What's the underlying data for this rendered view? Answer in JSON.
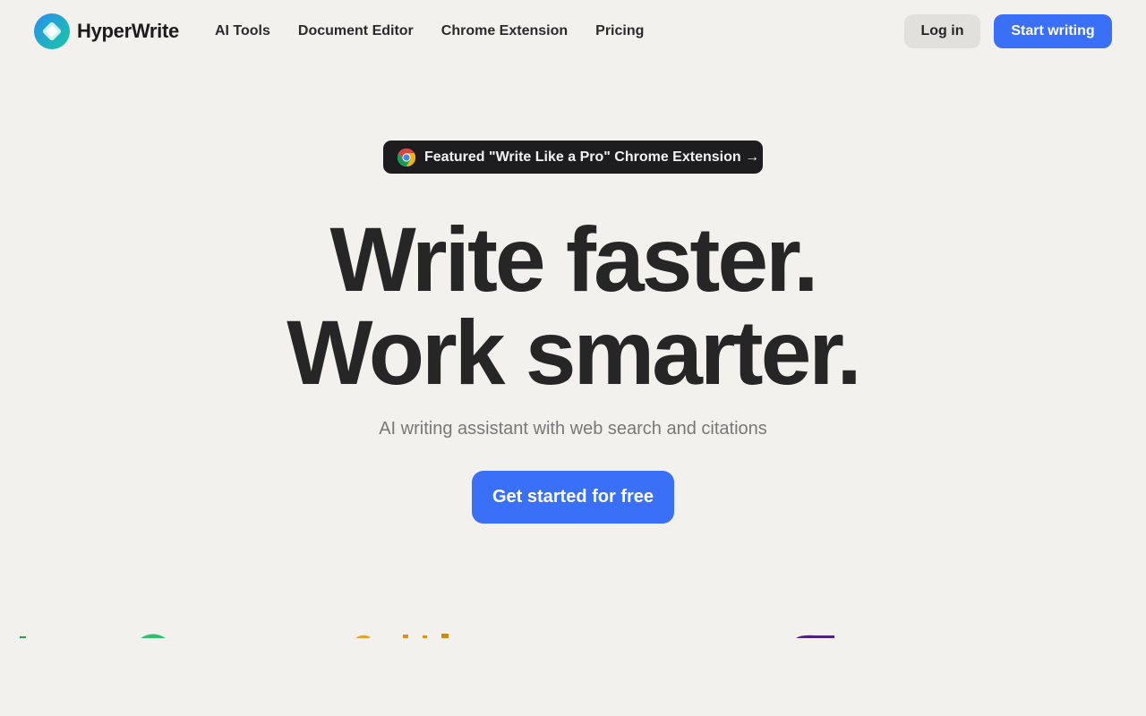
{
  "brand": {
    "name": "HyperWrite"
  },
  "nav": {
    "links": [
      "AI Tools",
      "Document Editor",
      "Chrome Extension",
      "Pricing"
    ],
    "login_label": "Log in",
    "start_label": "Start writing"
  },
  "featured": {
    "text": "Featured \"Write Like a Pro\" Chrome Extension →"
  },
  "hero": {
    "title_line1": "Write faster.",
    "title_line2": "Work smarter.",
    "subtitle": "AI writing assistant with web search and citations",
    "cta_label": "Get started for free"
  },
  "colors": {
    "background": "#f2f1ee",
    "accent": "#3a6ff8",
    "pill": "#1d1d1f"
  },
  "icons": [
    "hyperwrite-logo-icon",
    "chrome-icon"
  ]
}
